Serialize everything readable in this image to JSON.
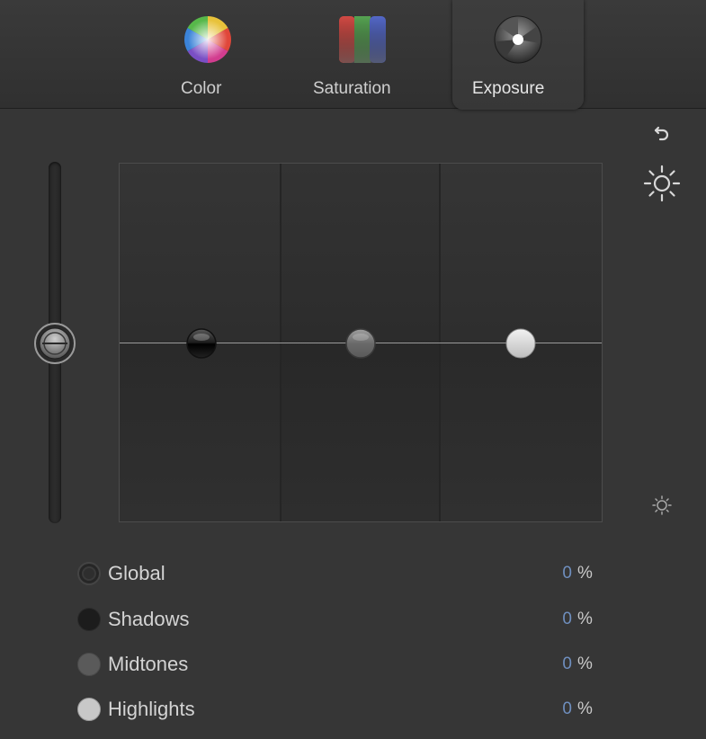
{
  "tabs": [
    {
      "label": "Color",
      "icon": "color-wheel-icon",
      "active": false
    },
    {
      "label": "Saturation",
      "icon": "saturation-icon",
      "active": false
    },
    {
      "label": "Exposure",
      "icon": "exposure-icon",
      "active": true
    }
  ],
  "side_icons": [
    "reset-arrow-icon",
    "brightness-high-icon",
    "brightness-low-icon"
  ],
  "controls": [
    {
      "label": "Global",
      "value": "0",
      "unit": "%",
      "dot_color": "#2e2e2e"
    },
    {
      "label": "Shadows",
      "value": "0",
      "unit": "%",
      "dot_color": "#1c1c1c"
    },
    {
      "label": "Midtones",
      "value": "0",
      "unit": "%",
      "dot_color": "#5a5a5a"
    },
    {
      "label": "Highlights",
      "value": "0",
      "unit": "%",
      "dot_color": "#c8c8c8"
    }
  ],
  "colors": {
    "background": "#363636",
    "value_text": "#6f8fbf",
    "label_text": "#d4d4d4"
  }
}
